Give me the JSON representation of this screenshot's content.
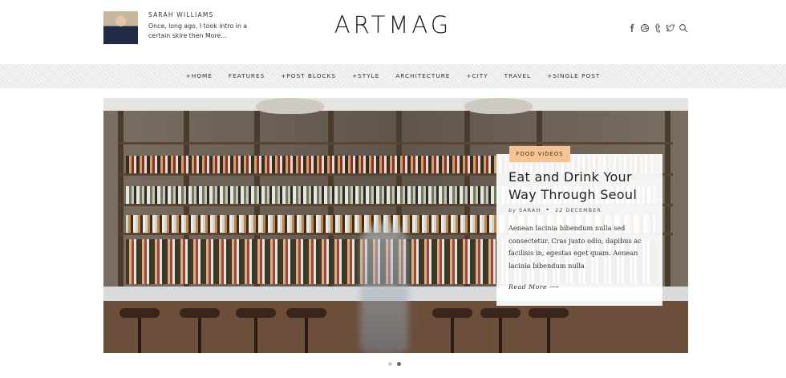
{
  "author": {
    "name": "SARAH WILLIAMS",
    "intro": "Once, long ago, I took intro in a certain skire then More..."
  },
  "logo": "ARTMAG",
  "social_icons": [
    "facebook-icon",
    "dribbble-icon",
    "tumblr-icon",
    "twitter-icon",
    "search-icon"
  ],
  "nav": [
    "+HOME",
    "FEATURES",
    "+POST BLOCKS",
    "+STYLE",
    "ARCHITECTURE",
    "+CITY",
    "TRAVEL",
    "+SINGLE POST"
  ],
  "slide": {
    "category": "FOOD VIDEOS",
    "title": "Eat and Drink Your Way Through Seoul",
    "by": "by",
    "author": "SARAH",
    "date": "22 DECEMBER",
    "excerpt": "Aenean lacinia bibendum nulla sed consectetur. Cras justo odio, dapibus ac facilisis in, egestas eget quam. Aenean lacinia bibendum nulla",
    "read_more": "Read More ⟶"
  },
  "slider": {
    "total": 2,
    "active": 2
  },
  "colors": {
    "category_bg": "#f7c392",
    "text": "#333333"
  }
}
